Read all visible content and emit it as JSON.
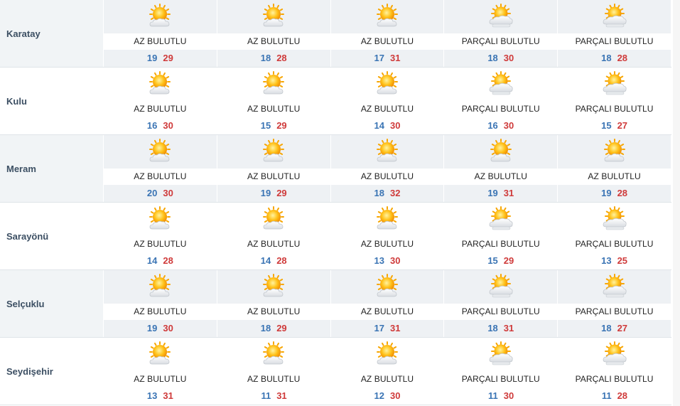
{
  "colors": {
    "min": "#3a74b4",
    "max": "#cf3a3a",
    "shade": "#eef1f4",
    "label": "#3c4f63"
  },
  "rows": [
    {
      "name": "Karatay",
      "days": [
        {
          "icon": "sunny-cloud-icon",
          "desc": "AZ BULUTLU",
          "min": "19",
          "max": "29"
        },
        {
          "icon": "sunny-cloud-icon",
          "desc": "AZ BULUTLU",
          "min": "18",
          "max": "28"
        },
        {
          "icon": "sunny-cloud-icon",
          "desc": "AZ BULUTLU",
          "min": "17",
          "max": "31"
        },
        {
          "icon": "partly-cloudy-icon",
          "desc": "PARÇALI BULUTLU",
          "min": "18",
          "max": "30"
        },
        {
          "icon": "partly-cloudy-icon",
          "desc": "PARÇALI BULUTLU",
          "min": "18",
          "max": "28"
        }
      ]
    },
    {
      "name": "Kulu",
      "days": [
        {
          "icon": "sunny-cloud-icon",
          "desc": "AZ BULUTLU",
          "min": "16",
          "max": "30"
        },
        {
          "icon": "sunny-cloud-icon",
          "desc": "AZ BULUTLU",
          "min": "15",
          "max": "29"
        },
        {
          "icon": "sunny-cloud-icon",
          "desc": "AZ BULUTLU",
          "min": "14",
          "max": "30"
        },
        {
          "icon": "partly-cloudy-icon",
          "desc": "PARÇALI BULUTLU",
          "min": "16",
          "max": "30"
        },
        {
          "icon": "partly-cloudy-icon",
          "desc": "PARÇALI BULUTLU",
          "min": "15",
          "max": "27"
        }
      ]
    },
    {
      "name": "Meram",
      "days": [
        {
          "icon": "sunny-cloud-icon",
          "desc": "AZ BULUTLU",
          "min": "20",
          "max": "30"
        },
        {
          "icon": "sunny-cloud-icon",
          "desc": "AZ BULUTLU",
          "min": "19",
          "max": "29"
        },
        {
          "icon": "sunny-cloud-icon",
          "desc": "AZ BULUTLU",
          "min": "18",
          "max": "32"
        },
        {
          "icon": "sunny-cloud-icon",
          "desc": "AZ BULUTLU",
          "min": "19",
          "max": "31"
        },
        {
          "icon": "sunny-cloud-icon",
          "desc": "AZ BULUTLU",
          "min": "19",
          "max": "28"
        }
      ]
    },
    {
      "name": "Sarayönü",
      "days": [
        {
          "icon": "sunny-cloud-icon",
          "desc": "AZ BULUTLU",
          "min": "14",
          "max": "28"
        },
        {
          "icon": "sunny-cloud-icon",
          "desc": "AZ BULUTLU",
          "min": "14",
          "max": "28"
        },
        {
          "icon": "sunny-cloud-icon",
          "desc": "AZ BULUTLU",
          "min": "13",
          "max": "30"
        },
        {
          "icon": "partly-cloudy-icon",
          "desc": "PARÇALI BULUTLU",
          "min": "15",
          "max": "29"
        },
        {
          "icon": "partly-cloudy-icon",
          "desc": "PARÇALI BULUTLU",
          "min": "13",
          "max": "25"
        }
      ]
    },
    {
      "name": "Selçuklu",
      "days": [
        {
          "icon": "sunny-cloud-icon",
          "desc": "AZ BULUTLU",
          "min": "19",
          "max": "30"
        },
        {
          "icon": "sunny-cloud-icon",
          "desc": "AZ BULUTLU",
          "min": "18",
          "max": "29"
        },
        {
          "icon": "sunny-cloud-icon",
          "desc": "AZ BULUTLU",
          "min": "17",
          "max": "31"
        },
        {
          "icon": "partly-cloudy-icon",
          "desc": "PARÇALI BULUTLU",
          "min": "18",
          "max": "31"
        },
        {
          "icon": "partly-cloudy-icon",
          "desc": "PARÇALI BULUTLU",
          "min": "18",
          "max": "27"
        }
      ]
    },
    {
      "name": "Seydişehir",
      "days": [
        {
          "icon": "sunny-cloud-icon",
          "desc": "AZ BULUTLU",
          "min": "13",
          "max": "31"
        },
        {
          "icon": "sunny-cloud-icon",
          "desc": "AZ BULUTLU",
          "min": "11",
          "max": "31"
        },
        {
          "icon": "sunny-cloud-icon",
          "desc": "AZ BULUTLU",
          "min": "12",
          "max": "30"
        },
        {
          "icon": "partly-cloudy-icon",
          "desc": "PARÇALI BULUTLU",
          "min": "11",
          "max": "30"
        },
        {
          "icon": "partly-cloudy-icon",
          "desc": "PARÇALI BULUTLU",
          "min": "11",
          "max": "28"
        }
      ]
    }
  ]
}
